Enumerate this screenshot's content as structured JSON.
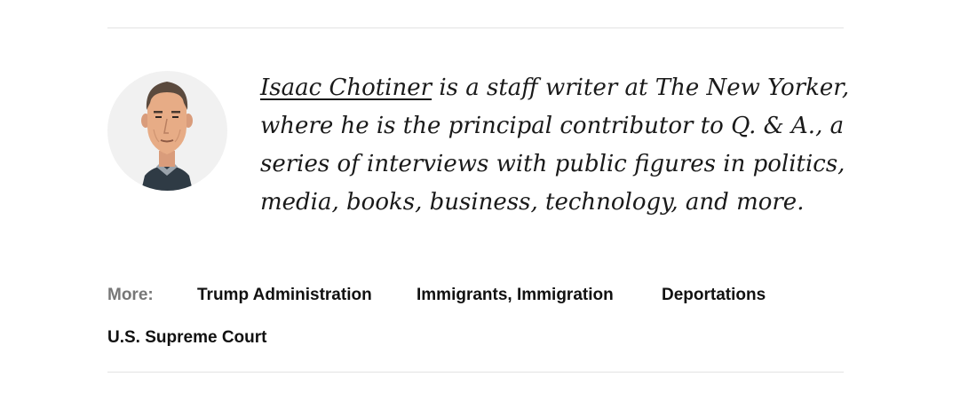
{
  "author": {
    "name": "Isaac Chotiner",
    "bio_lines": [
      " is a staff writer at The New Yorker,",
      "where he is the principal contributor to Q. & A., a",
      "series of interviews with public figures in politics,",
      "media, books, business, technology, and more."
    ],
    "avatar_icon": "author-illustration-avatar"
  },
  "more": {
    "label": "More:",
    "tags": [
      "Trump Administration",
      "Immigrants, Immigration",
      "Deportations",
      "U.S. Supreme Court"
    ]
  },
  "colors": {
    "divider": "#e3e3e3",
    "avatar_bg": "#f1f1f1",
    "label_gray": "#777777",
    "text": "#111111"
  }
}
